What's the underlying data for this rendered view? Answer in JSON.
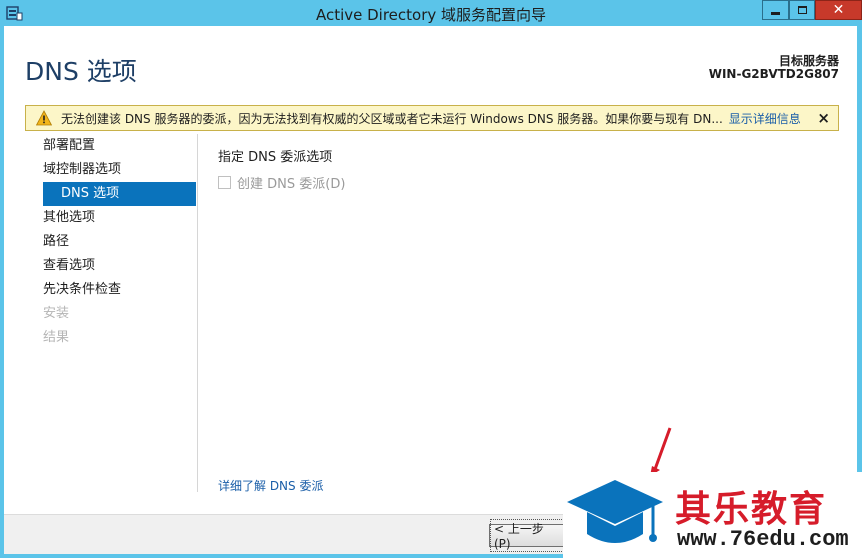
{
  "window": {
    "title": "Active Directory 域服务配置向导"
  },
  "header": {
    "page_title": "DNS 选项",
    "target_label": "目标服务器",
    "target_value": "WIN-G2BVTD2G807"
  },
  "warning": {
    "text": "无法创建该 DNS 服务器的委派，因为无法找到有权威的父区域或者它未运行 Windows DNS 服务器。如果你要与现有 DN...",
    "link": "显示详细信息",
    "close": "×"
  },
  "nav": {
    "items": [
      {
        "label": "部署配置",
        "state": "normal"
      },
      {
        "label": "域控制器选项",
        "state": "normal"
      },
      {
        "label": "DNS 选项",
        "state": "active"
      },
      {
        "label": "其他选项",
        "state": "normal"
      },
      {
        "label": "路径",
        "state": "normal"
      },
      {
        "label": "查看选项",
        "state": "normal"
      },
      {
        "label": "先决条件检查",
        "state": "normal"
      },
      {
        "label": "安装",
        "state": "disabled"
      },
      {
        "label": "结果",
        "state": "disabled"
      }
    ]
  },
  "content": {
    "section_heading": "指定 DNS 委派选项",
    "checkbox_label": "创建 DNS 委派(D)",
    "checkbox_checked": false,
    "learn_more": "详细了解 DNS 委派"
  },
  "footer": {
    "prev_label": "< 上一步(P)"
  },
  "watermark": {
    "brand": "其乐教育",
    "url": "www.76edu.com"
  },
  "colors": {
    "titlebar": "#5bc4e9",
    "accent": "#0a73bc",
    "page_title": "#1e3f66",
    "warning_bg": "#fcf6c8",
    "link": "#1a5ea8",
    "watermark_red": "#d61c2a",
    "watermark_blue": "#0a73bc"
  },
  "icons": {
    "app": "server-wizard-icon",
    "warning": "warning-triangle-icon",
    "watermark": "graduation-cap-icon"
  }
}
